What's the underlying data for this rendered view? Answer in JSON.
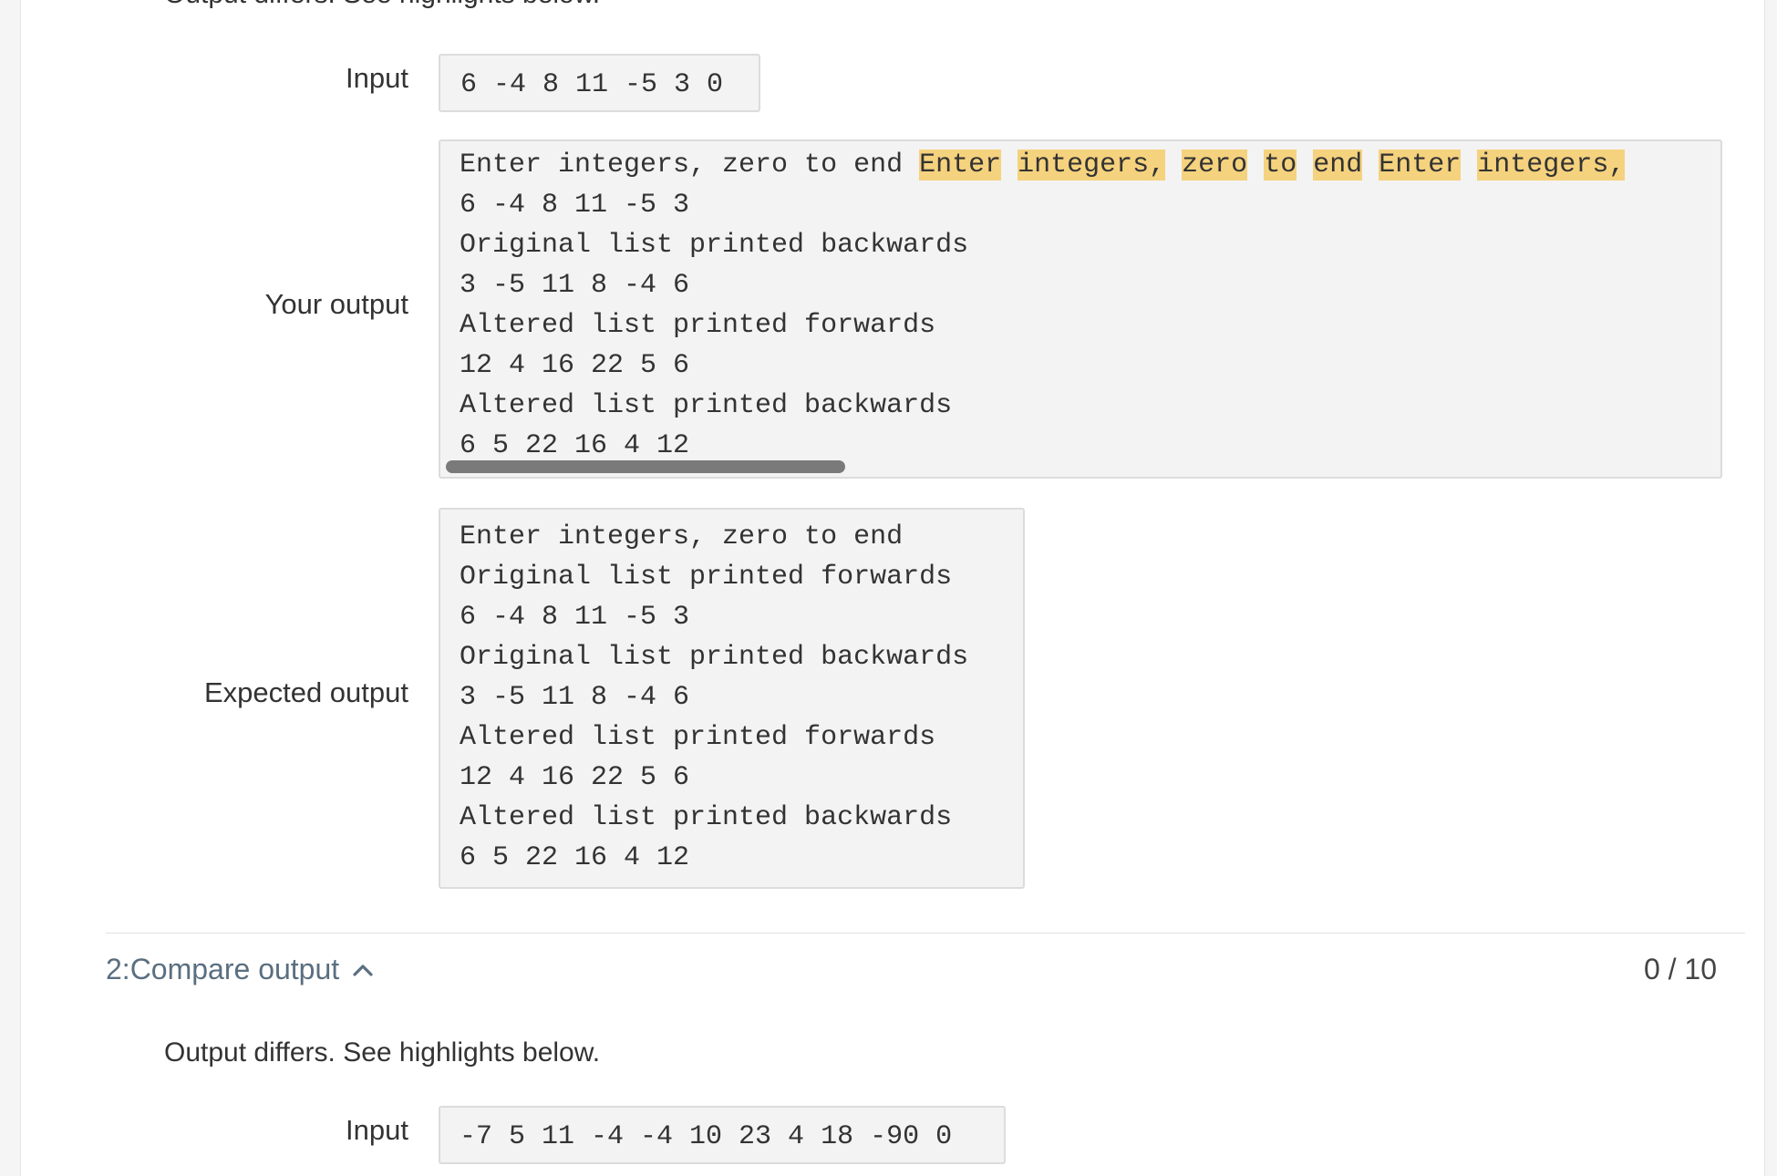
{
  "test1": {
    "diff_note": "Output differs. See highlights below.",
    "input_label": "Input",
    "input_value": "6 -4 8 11 -5 3 0",
    "your_output_label": "Your output",
    "your_output_lines": [
      [
        {
          "text": "Enter integers, zero to end ",
          "hl": false
        },
        {
          "text": "Enter",
          "hl": true
        },
        {
          "text": " ",
          "hl": false
        },
        {
          "text": "integers,",
          "hl": true
        },
        {
          "text": " ",
          "hl": false
        },
        {
          "text": "zero",
          "hl": true
        },
        {
          "text": " ",
          "hl": false
        },
        {
          "text": "to",
          "hl": true
        },
        {
          "text": " ",
          "hl": false
        },
        {
          "text": "end",
          "hl": true
        },
        {
          "text": " ",
          "hl": false
        },
        {
          "text": "Enter",
          "hl": true
        },
        {
          "text": " ",
          "hl": false
        },
        {
          "text": "integers,",
          "hl": true
        }
      ],
      [
        {
          "text": "6 -4 8 11 -5 3",
          "hl": false
        }
      ],
      [
        {
          "text": "Original list printed backwards",
          "hl": false
        }
      ],
      [
        {
          "text": "3 -5 11 8 -4 6",
          "hl": false
        }
      ],
      [
        {
          "text": "Altered list printed forwards",
          "hl": false
        }
      ],
      [
        {
          "text": "12 4 16 22 5 6",
          "hl": false
        }
      ],
      [
        {
          "text": "Altered list printed backwards",
          "hl": false
        }
      ],
      [
        {
          "text": "6 5 22 16 4 12",
          "hl": false
        }
      ]
    ],
    "expected_output_label": "Expected output",
    "expected_output_lines": [
      "Enter integers, zero to end",
      "Original list printed forwards",
      "6 -4 8 11 -5 3",
      "Original list printed backwards",
      "3 -5 11 8 -4 6",
      "Altered list printed forwards",
      "12 4 16 22 5 6",
      "Altered list printed backwards",
      "6 5 22 16 4 12"
    ]
  },
  "test2": {
    "title": "2:Compare output",
    "toggle_icon": "chevron-up-icon",
    "score": "0 / 10",
    "diff_note": "Output differs. See highlights below.",
    "input_label": "Input",
    "input_value": "-7 5 11 -4 -4 10 23 4 18 -90 0"
  },
  "colors": {
    "highlight": "#f5d27e",
    "section_title": "#5a6f80",
    "box_bg": "#f3f3f3"
  }
}
